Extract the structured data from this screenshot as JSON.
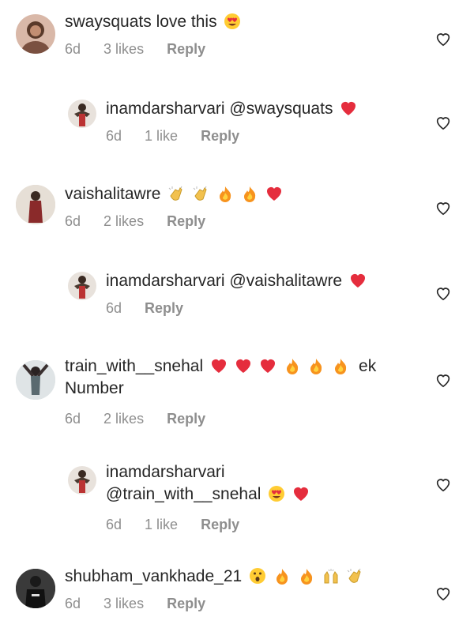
{
  "comments": [
    {
      "username": "swaysquats",
      "text": "love this",
      "emojis": [
        "heart-eyes"
      ],
      "age": "6d",
      "likes": "3 likes",
      "reply": "Reply"
    },
    {
      "username": "inamdarsharvari",
      "text": "@swaysquats",
      "emojis": [
        "red-heart"
      ],
      "age": "6d",
      "likes": "1 like",
      "reply": "Reply"
    },
    {
      "username": "vaishalitawre",
      "text": "",
      "emojis": [
        "clap",
        "clap",
        "fire",
        "fire",
        "red-heart"
      ],
      "age": "6d",
      "likes": "2 likes",
      "reply": "Reply"
    },
    {
      "username": "inamdarsharvari",
      "text": "@vaishalitawre",
      "emojis": [
        "red-heart"
      ],
      "age": "6d",
      "likes": "",
      "reply": "Reply"
    },
    {
      "username": "train_with__snehal",
      "text": "ek",
      "text2": "Number",
      "emojis": [
        "red-heart",
        "red-heart",
        "red-heart",
        "fire",
        "fire",
        "fire"
      ],
      "age": "6d",
      "likes": "2 likes",
      "reply": "Reply"
    },
    {
      "username": "inamdarsharvari",
      "text": "@train_with__snehal",
      "emojis": [
        "heart-eyes",
        "red-heart"
      ],
      "age": "6d",
      "likes": "1 like",
      "reply": "Reply"
    },
    {
      "username": "shubham_vankhade_21",
      "text": "",
      "emojis": [
        "surprised",
        "fire",
        "fire",
        "raised-hands",
        "clap"
      ],
      "age": "6d",
      "likes": "3 likes",
      "reply": "Reply"
    }
  ],
  "colors": {
    "text": "#262626",
    "meta": "#8e8e8e",
    "heart_red": "#ed3b3b",
    "fire": "#f7931e"
  }
}
